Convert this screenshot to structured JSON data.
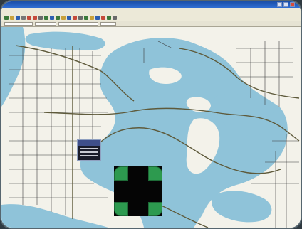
{
  "window": {
    "title": "",
    "menu": [
      "",
      "",
      "",
      "",
      "",
      ""
    ]
  },
  "colors": {
    "water": "#8fc3d9",
    "land": "#f3f2ea",
    "roads": "#2a2a2a",
    "highway": "#5e5a3b",
    "accent_green": "#2d9a4f",
    "panel_black": "#050505"
  },
  "toolbar": {
    "icons": [
      "new-icon",
      "open-icon",
      "save-icon",
      "print-icon",
      "zoom-in-icon",
      "zoom-out-icon",
      "pan-icon",
      "select-icon",
      "measure-icon",
      "layer-icon",
      "info-icon",
      "route-icon",
      "marker-icon",
      "settings-icon",
      "help-icon"
    ]
  },
  "popup": {
    "title": "",
    "body": ""
  },
  "pan_control": {
    "label": ""
  }
}
